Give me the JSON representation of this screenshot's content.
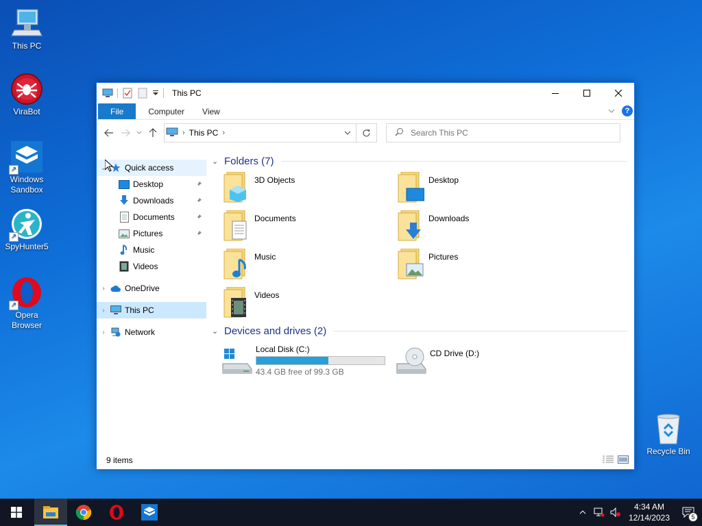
{
  "desktop": {
    "icons": [
      {
        "label": "This PC",
        "icon": "computer-icon"
      },
      {
        "label": "ViraBot",
        "icon": "virabot-icon"
      },
      {
        "label": "Windows Sandbox",
        "icon": "sandbox-icon"
      },
      {
        "label": "SpyHunter5",
        "icon": "spyhunter-icon"
      },
      {
        "label": "Opera Browser",
        "icon": "opera-icon"
      },
      {
        "label": "Recycle Bin",
        "icon": "recycle-bin-icon"
      }
    ]
  },
  "window": {
    "title": "This PC",
    "ribbon_tabs": [
      "File",
      "Computer",
      "View"
    ],
    "address": {
      "location": "This PC"
    },
    "search": {
      "placeholder": "Search This PC"
    },
    "sidebar": {
      "quick_access": "Quick access",
      "quick_items": [
        "Desktop",
        "Downloads",
        "Documents",
        "Pictures",
        "Music",
        "Videos"
      ],
      "onedrive": "OneDrive",
      "this_pc": "This PC",
      "network": "Network"
    },
    "folders_header": "Folders (7)",
    "folders": [
      "3D Objects",
      "Desktop",
      "Documents",
      "Downloads",
      "Music",
      "Pictures",
      "Videos"
    ],
    "drives_header": "Devices and drives (2)",
    "drives": [
      {
        "name": "Local Disk (C:)",
        "free_text": "43.4 GB free of 99.3 GB",
        "used_fraction": 0.563
      },
      {
        "name": "CD Drive (D:)"
      }
    ],
    "status": "9 items"
  },
  "taskbar": {
    "time": "4:34 AM",
    "date": "12/14/2023",
    "notification_count": "5"
  },
  "colors": {
    "accent": "#1979ca",
    "drive_bar": "#26a0da",
    "group_header": "#1e3287",
    "taskbar": "#101623"
  }
}
